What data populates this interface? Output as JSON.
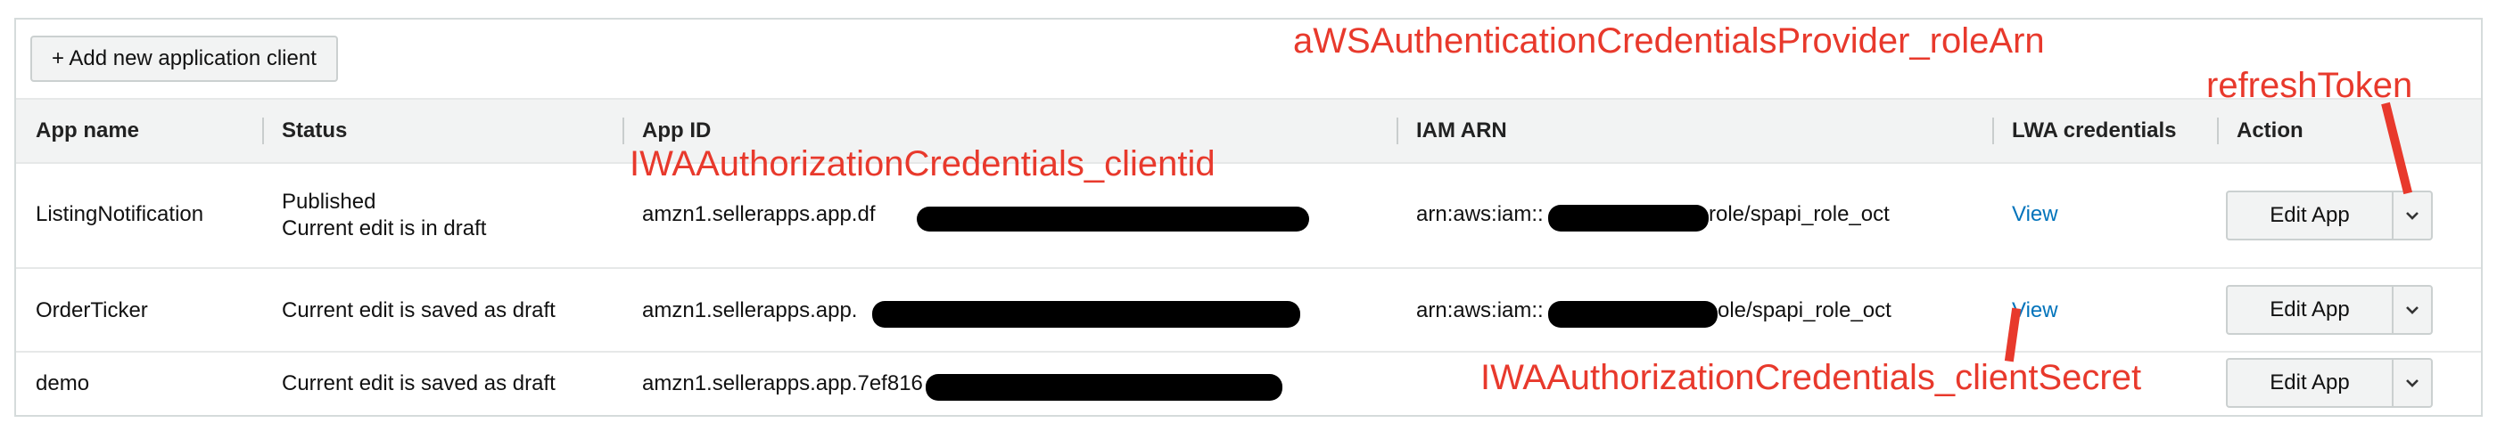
{
  "toolbar": {
    "add_label": "+ Add new application client"
  },
  "columns": {
    "app_name": "App name",
    "status": "Status",
    "app_id": "App ID",
    "iam_arn": "IAM ARN",
    "lwa": "LWA credentials",
    "action": "Action"
  },
  "rows": [
    {
      "name": "ListingNotification",
      "status_line1": "Published",
      "status_line2": "Current edit is in draft",
      "app_id_prefix": "amzn1.sellerapps.app.df",
      "arn_prefix": "arn:aws:iam::",
      "arn_suffix": "role/spapi_role_oct",
      "lwa": "View",
      "edit": "Edit App"
    },
    {
      "name": "OrderTicker",
      "status_line1": "Current edit is saved as draft",
      "app_id_prefix": "amzn1.sellerapps.app.",
      "arn_prefix": "arn:aws:iam::",
      "arn_suffix": "ole/spapi_role_oct",
      "lwa": "View",
      "edit": "Edit App"
    },
    {
      "name": "demo",
      "status_line1": "Current edit is saved as draft",
      "app_id_prefix": "amzn1.sellerapps.app.7ef816",
      "lwa": "",
      "edit": "Edit App"
    }
  ],
  "annotations": {
    "role_arn": "aWSAuthenticationCredentialsProvider_roleArn",
    "client_id": "IWAAuthorizationCredentials_clientid",
    "refresh_token": "refreshToken",
    "client_secret": "IWAAuthorizationCredentials_clientSecret"
  },
  "colors": {
    "link": "#0073bb",
    "annotation": "#e8392c",
    "header_bg": "#f2f3f3"
  },
  "icons": {
    "dropdown": "chevron-down-icon"
  }
}
